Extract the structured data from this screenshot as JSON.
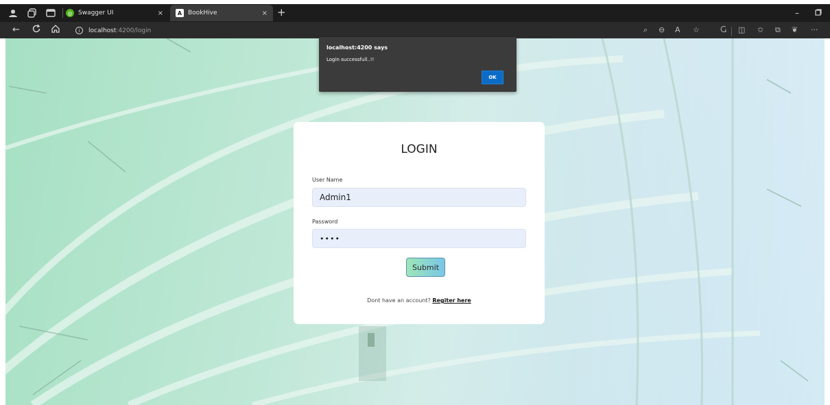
{
  "browser": {
    "tabs": [
      {
        "label": "Swagger UI",
        "close": "×",
        "favicon": "swagger-icon"
      },
      {
        "label": "BookHive",
        "close": "×",
        "favicon": "angular-icon"
      }
    ],
    "new_tab": "+",
    "url": {
      "host": "localhost",
      "path": ":4200/login"
    },
    "window_controls": {
      "minimize": "–",
      "restore": "□"
    }
  },
  "alert": {
    "title": "localhost:4200 says",
    "message": "Login successfull..!!",
    "ok_label": "OK",
    "ok_color": "#0b6cc7"
  },
  "login": {
    "title": "LOGIN",
    "username_label": "User Name",
    "username_value": "Admin1",
    "password_label": "Password",
    "password_value": "••••",
    "submit_label": "Submit",
    "footer_text": "Dont have an account?",
    "register_link": "Regiter here"
  }
}
